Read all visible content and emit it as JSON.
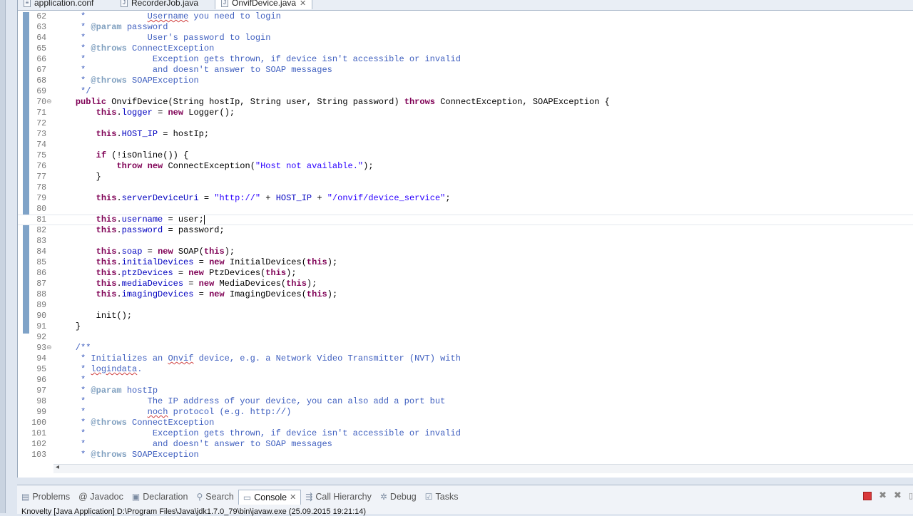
{
  "tabs": [
    {
      "label": "application.conf"
    },
    {
      "label": "RecorderJob.java"
    },
    {
      "label": "OnvifDevice.java",
      "active": true
    }
  ],
  "editor": {
    "lines": [
      {
        "n": "62",
        "t": "     *            Username you need to login"
      },
      {
        "n": "63",
        "t": "     * @param password"
      },
      {
        "n": "64",
        "t": "     *            User's password to login"
      },
      {
        "n": "65",
        "t": "     * @throws ConnectException"
      },
      {
        "n": "66",
        "t": "     *             Exception gets thrown, if device isn't accessible or invalid"
      },
      {
        "n": "67",
        "t": "     *             and doesn't answer to SOAP messages"
      },
      {
        "n": "68",
        "t": "     * @throws SOAPException"
      },
      {
        "n": "69",
        "t": "     */"
      },
      {
        "n": "70",
        "t": "    public OnvifDevice(String hostIp, String user, String password) throws ConnectException, SOAPException {"
      },
      {
        "n": "71",
        "t": "        this.logger = new Logger();"
      },
      {
        "n": "72",
        "t": ""
      },
      {
        "n": "73",
        "t": "        this.HOST_IP = hostIp;"
      },
      {
        "n": "74",
        "t": ""
      },
      {
        "n": "75",
        "t": "        if (!isOnline()) {"
      },
      {
        "n": "76",
        "t": "            throw new ConnectException(\"Host not available.\");"
      },
      {
        "n": "77",
        "t": "        }"
      },
      {
        "n": "78",
        "t": ""
      },
      {
        "n": "79",
        "t": "        this.serverDeviceUri = \"http://\" + HOST_IP + \"/onvif/device_service\";"
      },
      {
        "n": "80",
        "t": ""
      },
      {
        "n": "81",
        "t": "        this.username = user;"
      },
      {
        "n": "82",
        "t": "        this.password = password;"
      },
      {
        "n": "83",
        "t": ""
      },
      {
        "n": "84",
        "t": "        this.soap = new SOAP(this);"
      },
      {
        "n": "85",
        "t": "        this.initialDevices = new InitialDevices(this);"
      },
      {
        "n": "86",
        "t": "        this.ptzDevices = new PtzDevices(this);"
      },
      {
        "n": "87",
        "t": "        this.mediaDevices = new MediaDevices(this);"
      },
      {
        "n": "88",
        "t": "        this.imagingDevices = new ImagingDevices(this);"
      },
      {
        "n": "89",
        "t": ""
      },
      {
        "n": "90",
        "t": "        init();"
      },
      {
        "n": "91",
        "t": "    }"
      },
      {
        "n": "92",
        "t": ""
      },
      {
        "n": "93",
        "t": "    /**"
      },
      {
        "n": "94",
        "t": "     * Initializes an Onvif device, e.g. a Network Video Transmitter (NVT) with"
      },
      {
        "n": "95",
        "t": "     * logindata."
      },
      {
        "n": "96",
        "t": "     *"
      },
      {
        "n": "97",
        "t": "     * @param hostIp"
      },
      {
        "n": "98",
        "t": "     *            The IP address of your device, you can also add a port but"
      },
      {
        "n": "99",
        "t": "     *            noch protocol (e.g. http://)"
      },
      {
        "n": "100",
        "t": "     * @throws ConnectException"
      },
      {
        "n": "101",
        "t": "     *             Exception gets thrown, if device isn't accessible or invalid"
      },
      {
        "n": "102",
        "t": "     *             and doesn't answer to SOAP messages"
      },
      {
        "n": "103",
        "t": "     * @throws SOAPException"
      }
    ]
  },
  "views": [
    {
      "label": "Problems",
      "icon": "problems-icon"
    },
    {
      "label": "@ Javadoc",
      "icon": "javadoc-icon"
    },
    {
      "label": "Declaration",
      "icon": "declaration-icon"
    },
    {
      "label": "Search",
      "icon": "search-icon"
    },
    {
      "label": "Console",
      "icon": "console-icon",
      "active": true
    },
    {
      "label": "Call Hierarchy",
      "icon": "call-hierarchy-icon"
    },
    {
      "label": "Debug",
      "icon": "debug-icon"
    },
    {
      "label": "Tasks",
      "icon": "tasks-icon"
    }
  ],
  "console": {
    "status": "Knovelty [Java Application] D:\\Program Files\\Java\\jdk1.7.0_79\\bin\\javaw.exe (25.09.2015 19:21:14)"
  }
}
